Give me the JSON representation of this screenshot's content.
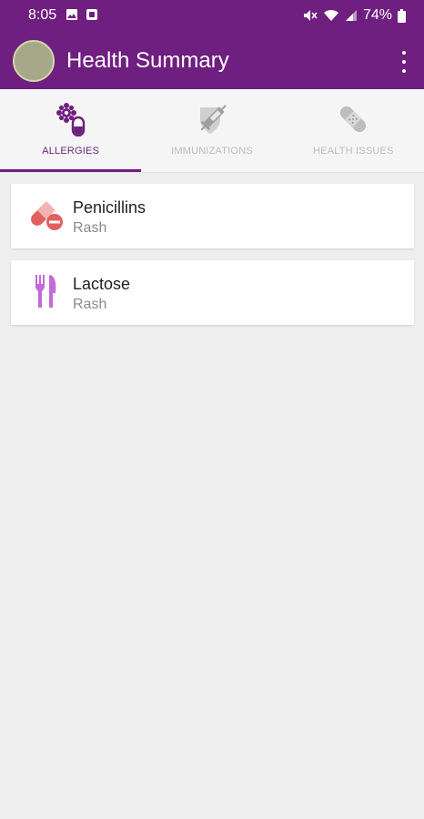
{
  "status_bar": {
    "time": "8:05",
    "battery": "74%",
    "icons": [
      "gallery-icon",
      "notification-app-icon",
      "mute-icon",
      "wifi-icon",
      "signal-icon",
      "battery-icon"
    ]
  },
  "app_bar": {
    "title": "Health Summary",
    "icons": [
      "avatar",
      "more-vert-icon"
    ]
  },
  "tabs": [
    {
      "label": "ALLERGIES",
      "icon": "allergies-icon",
      "active": true
    },
    {
      "label": "IMMUNIZATIONS",
      "icon": "syringe-shield-icon",
      "active": false
    },
    {
      "label": "HEALTH ISSUES",
      "icon": "bandage-icon",
      "active": false
    }
  ],
  "allergies": [
    {
      "name": "Penicillins",
      "reaction": "Rash",
      "icon": "pill-capsule-icon"
    },
    {
      "name": "Lactose",
      "reaction": "Rash",
      "icon": "fork-knife-icon"
    }
  ],
  "colors": {
    "primary": "#6f1f7f",
    "background": "#eeeeee",
    "pill_red": "#e0605f",
    "utensil_pink": "#c36ad8",
    "inactive_tab": "#bdbdbd"
  }
}
